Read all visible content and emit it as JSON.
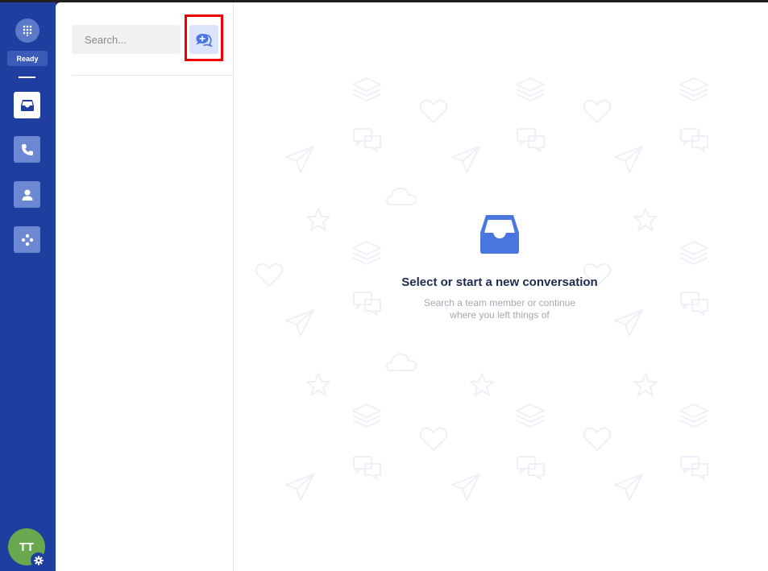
{
  "rail": {
    "status": "Ready",
    "nav_items": [
      "inbox",
      "calls",
      "contacts",
      "apps"
    ],
    "avatar_initials": "TT"
  },
  "conversations": {
    "search_placeholder": "Search...",
    "new_conversation_icon": "chat-plus-icon"
  },
  "empty_state": {
    "title": "Select or start a new conversation",
    "subtitle": "Search a team member or continue where you left things of"
  },
  "colors": {
    "rail": "#1e3fa0",
    "accent": "#4a76e0",
    "highlight": "#ee0000"
  }
}
